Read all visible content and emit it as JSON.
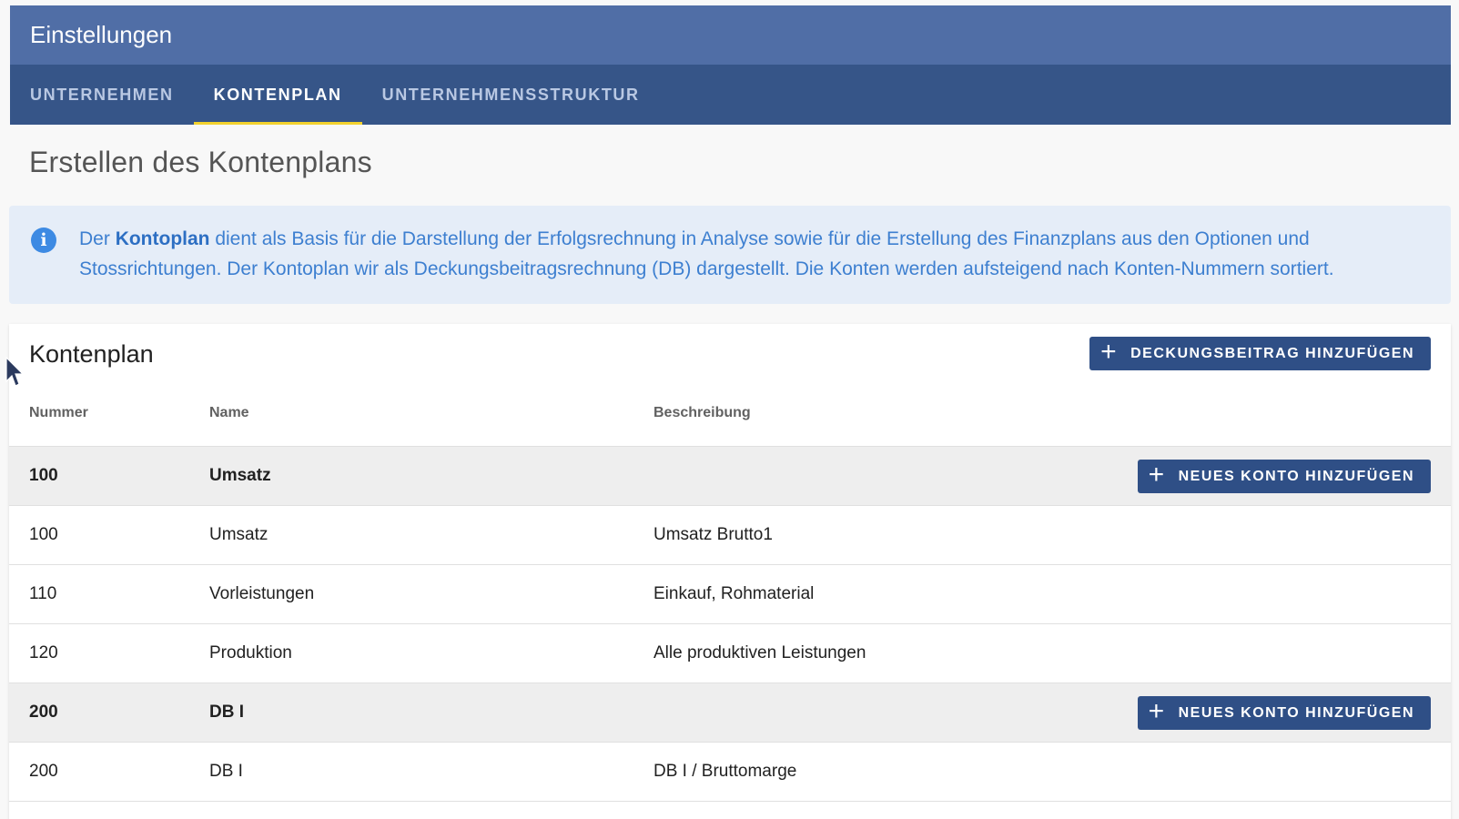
{
  "header": {
    "title": "Einstellungen",
    "tabs": [
      {
        "label": "UNTERNEHMEN",
        "active": false
      },
      {
        "label": "KONTENPLAN",
        "active": true
      },
      {
        "label": "UNTERNEHMENSSTRUKTUR",
        "active": false
      }
    ]
  },
  "page": {
    "title": "Erstellen des Kontenplans"
  },
  "info": {
    "icon": "info-icon",
    "prefix": "Der ",
    "bold": "Kontoplan",
    "text": " dient als Basis für die Darstellung der Erfolgsrechnung in Analyse sowie für die Erstellung des Finanzplans aus den Optionen und Stossrichtungen. Der Kontoplan wir als Deckungsbeitragsrechnung (DB) dargestellt. Die Konten werden aufsteigend nach Konten-Nummern sortiert."
  },
  "card": {
    "title": "Kontenplan",
    "add_db_label": "DECKUNGSBEITRAG HINZUFÜGEN",
    "columns": {
      "number": "Nummer",
      "name": "Name",
      "description": "Beschreibung"
    },
    "rows": [
      {
        "type": "group",
        "number": "100",
        "name": "Umsatz",
        "description": "",
        "button": "NEUES KONTO HINZUFÜGEN"
      },
      {
        "type": "item",
        "number": "100",
        "name": "Umsatz",
        "description": "Umsatz Brutto1"
      },
      {
        "type": "item",
        "number": "110",
        "name": "Vorleistungen",
        "description": "Einkauf, Rohmaterial"
      },
      {
        "type": "item",
        "number": "120",
        "name": "Produktion",
        "description": "Alle produktiven Leistungen"
      },
      {
        "type": "group",
        "number": "200",
        "name": "DB I",
        "description": "",
        "button": "NEUES KONTO HINZUFÜGEN"
      },
      {
        "type": "item",
        "number": "200",
        "name": "DB I",
        "description": "DB I / Bruttomarge"
      }
    ]
  },
  "colors": {
    "header_top": "#506ea6",
    "tab_bar": "#365588",
    "tab_indicator": "#f2d22e",
    "button": "#2f4f86",
    "info_bg": "#e5edf8",
    "info_text": "#3d7fd0"
  }
}
